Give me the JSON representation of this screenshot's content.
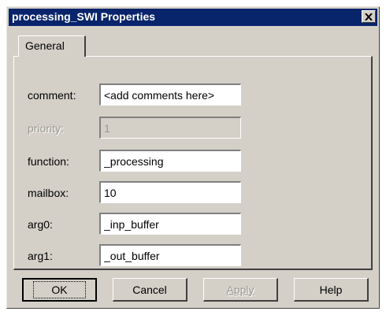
{
  "window": {
    "title": "processing_SWI Properties"
  },
  "tabs": [
    {
      "label": "General"
    }
  ],
  "fields": [
    {
      "label": "comment:",
      "value": "<add comments here>",
      "enabled": true
    },
    {
      "label": "priority:",
      "value": "1",
      "enabled": false
    },
    {
      "label": "function:",
      "value": "_processing",
      "enabled": true
    },
    {
      "label": "mailbox:",
      "value": "10",
      "enabled": true
    },
    {
      "label": "arg0:",
      "value": "_inp_buffer",
      "enabled": true
    },
    {
      "label": "arg1:",
      "value": "_out_buffer",
      "enabled": true
    }
  ],
  "buttons": {
    "ok": "OK",
    "cancel": "Cancel",
    "apply": "Apply",
    "help": "Help"
  },
  "colors": {
    "titlebar": "#08246b",
    "face": "#d4d0c8",
    "disabled_text": "#9a9890"
  },
  "icons": {
    "close": "close-icon"
  }
}
